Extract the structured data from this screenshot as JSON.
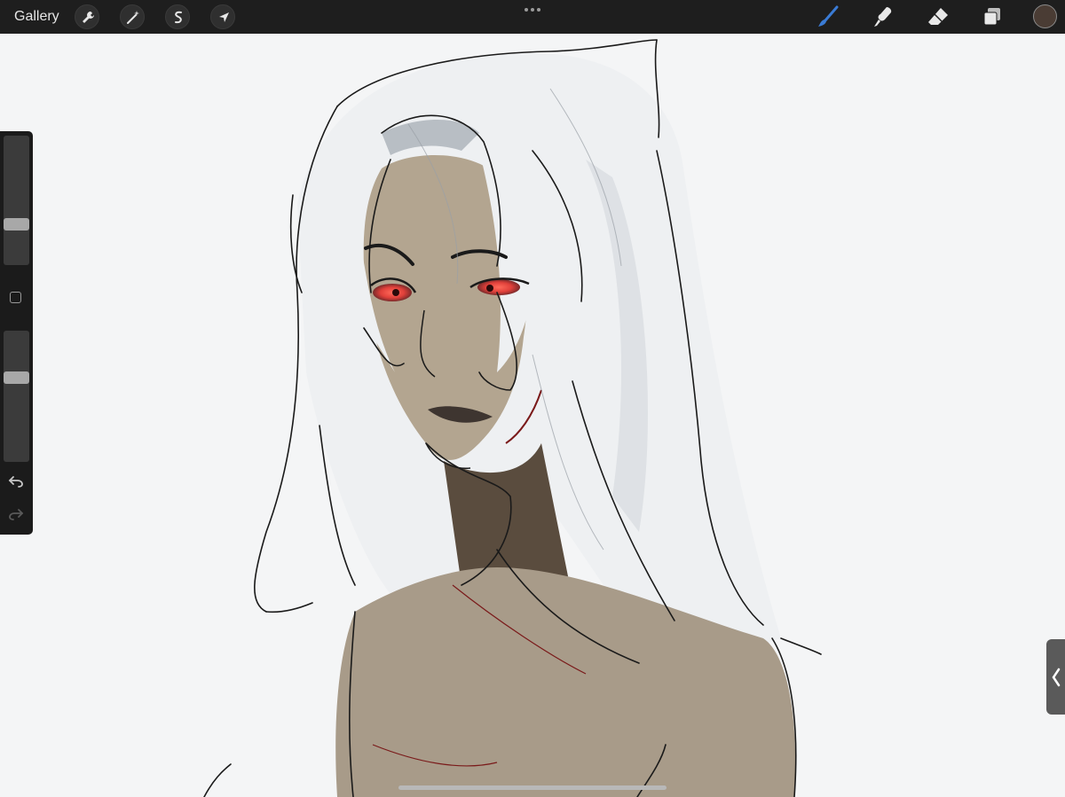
{
  "topbar": {
    "gallery_label": "Gallery",
    "left_tools": [
      "wrench-icon",
      "magic-wand-icon",
      "selection-icon",
      "transform-arrow-icon"
    ],
    "more_icon": "ellipsis-icon",
    "right_tools": [
      "brush-icon",
      "smudge-icon",
      "eraser-icon",
      "layers-icon"
    ],
    "active_tool": "brush-icon",
    "active_tool_color": "#3a7bd5",
    "current_color": "#4a3c34"
  },
  "sidebar": {
    "brush_size_level": 0.65,
    "opacity_level": 0.36,
    "controls": [
      "brush-size-slider",
      "modify-button",
      "opacity-slider",
      "undo-button",
      "redo-button"
    ]
  },
  "canvas": {
    "content": "sketch-illustration",
    "background": "#f4f5f6",
    "palette": {
      "hair": "#eef0f2",
      "skin": "#a89b89",
      "lines": "#1a1a1a",
      "eyes": "#e0403a",
      "accent_line": "#7a1a1a"
    }
  }
}
